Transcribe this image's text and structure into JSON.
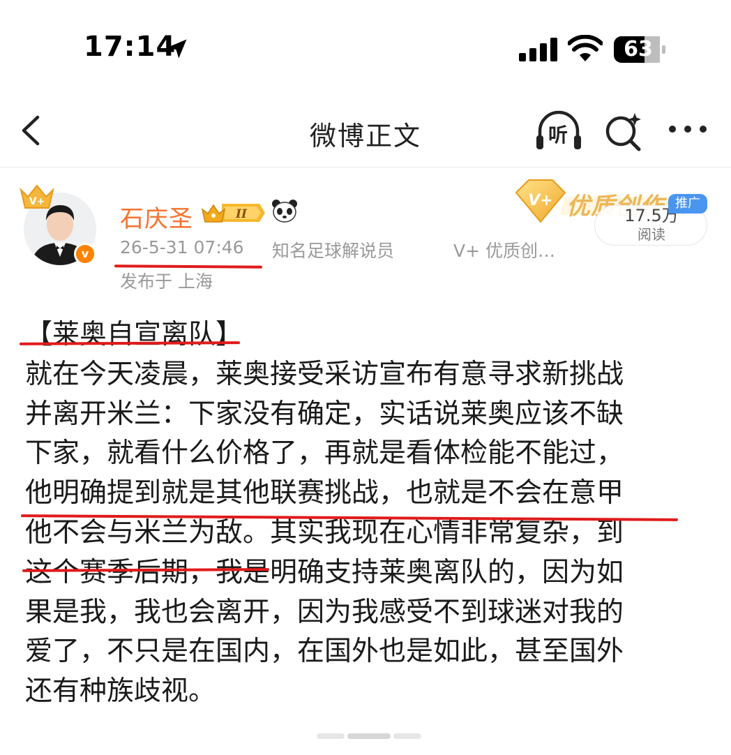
{
  "status_bar": {
    "time": "17:14",
    "battery": "63"
  },
  "nav": {
    "title": "微博正文",
    "listen_label": "听"
  },
  "author": {
    "name": "石庆圣",
    "rank_badge": "II",
    "post_time": "26-5-31 07:46",
    "description": "知名足球解说员",
    "vplus_description": "V+ 优质创…",
    "location": "发布于 上海",
    "verify_mark": "v",
    "quality_banner": "优质创作者",
    "views_count": "17.5万",
    "views_label": "阅读",
    "ad_tag": "推广"
  },
  "post": {
    "lines": [
      "【莱奥自宣离队】",
      "就在今天凌晨，莱奥接受采访宣布有意寻求新挑战",
      "并离开米兰：下家没有确定，实话说莱奥应该不缺",
      "下家，就看什么价格了，再就是看体检能不能过，",
      "他明确提到就是其他联赛挑战，也就是不会在意甲",
      "他不会与米兰为敌。其实我现在心情非常复杂，到",
      "这个赛季后期，我是明确支持莱奥离队的，因为如",
      "果是我，我也会离开，因为我感受不到球迷对我的",
      "爱了，不只是在国内，在国外也是如此，甚至国外",
      "还有种族歧视。"
    ]
  },
  "colors": {
    "accent": "#f7722f",
    "annotation_red": "#e01b1b",
    "ad_blue": "#4a95f0"
  }
}
